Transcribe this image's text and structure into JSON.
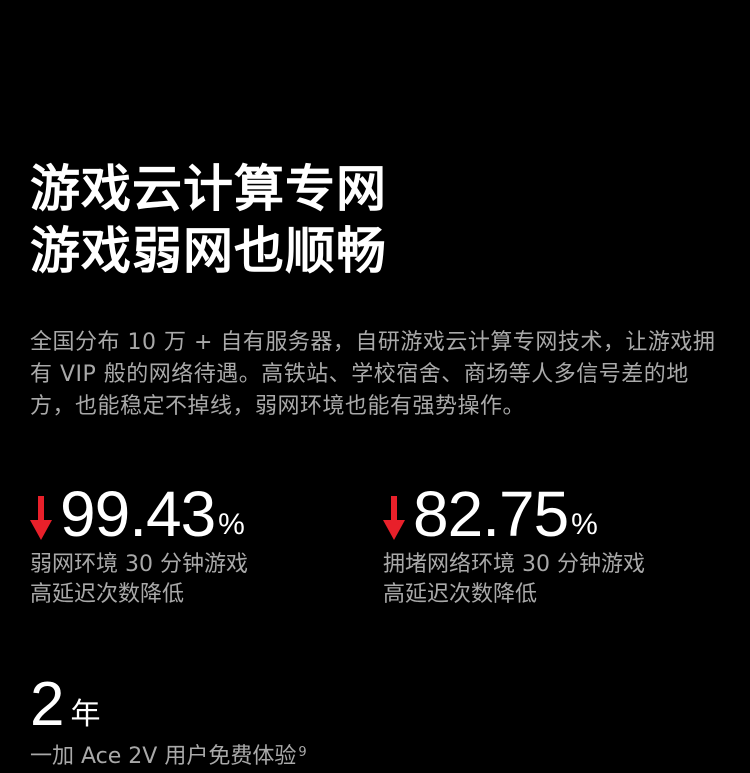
{
  "headline": {
    "line1": "游戏云计算专网",
    "line2": "游戏弱网也顺畅"
  },
  "description": "全国分布 10 万 + 自有服务器，自研游戏云计算专网技术，让游戏拥有 VIP 般的网络待遇。高铁站、学校宿舍、商场等人多信号差的地方，也能稳定不掉线，弱网环境也能有强势操作。",
  "stats": [
    {
      "icon": "down-arrow-icon",
      "value": "99.43",
      "unit": "%",
      "caption_line1": "弱网环境 30 分钟游戏",
      "caption_line2": "高延迟次数降低"
    },
    {
      "icon": "down-arrow-icon",
      "value": "82.75",
      "unit": "%",
      "caption_line1": "拥堵网络环境 30 分钟游戏",
      "caption_line2": "高延迟次数降低"
    }
  ],
  "years": {
    "value": "2",
    "unit": "年",
    "caption": "一加 Ace 2V 用户免费体验",
    "footnote": "9"
  },
  "colors": {
    "background": "#000000",
    "text": "#ffffff",
    "muted": "#a9a9a9",
    "accent": "#e8202a"
  }
}
